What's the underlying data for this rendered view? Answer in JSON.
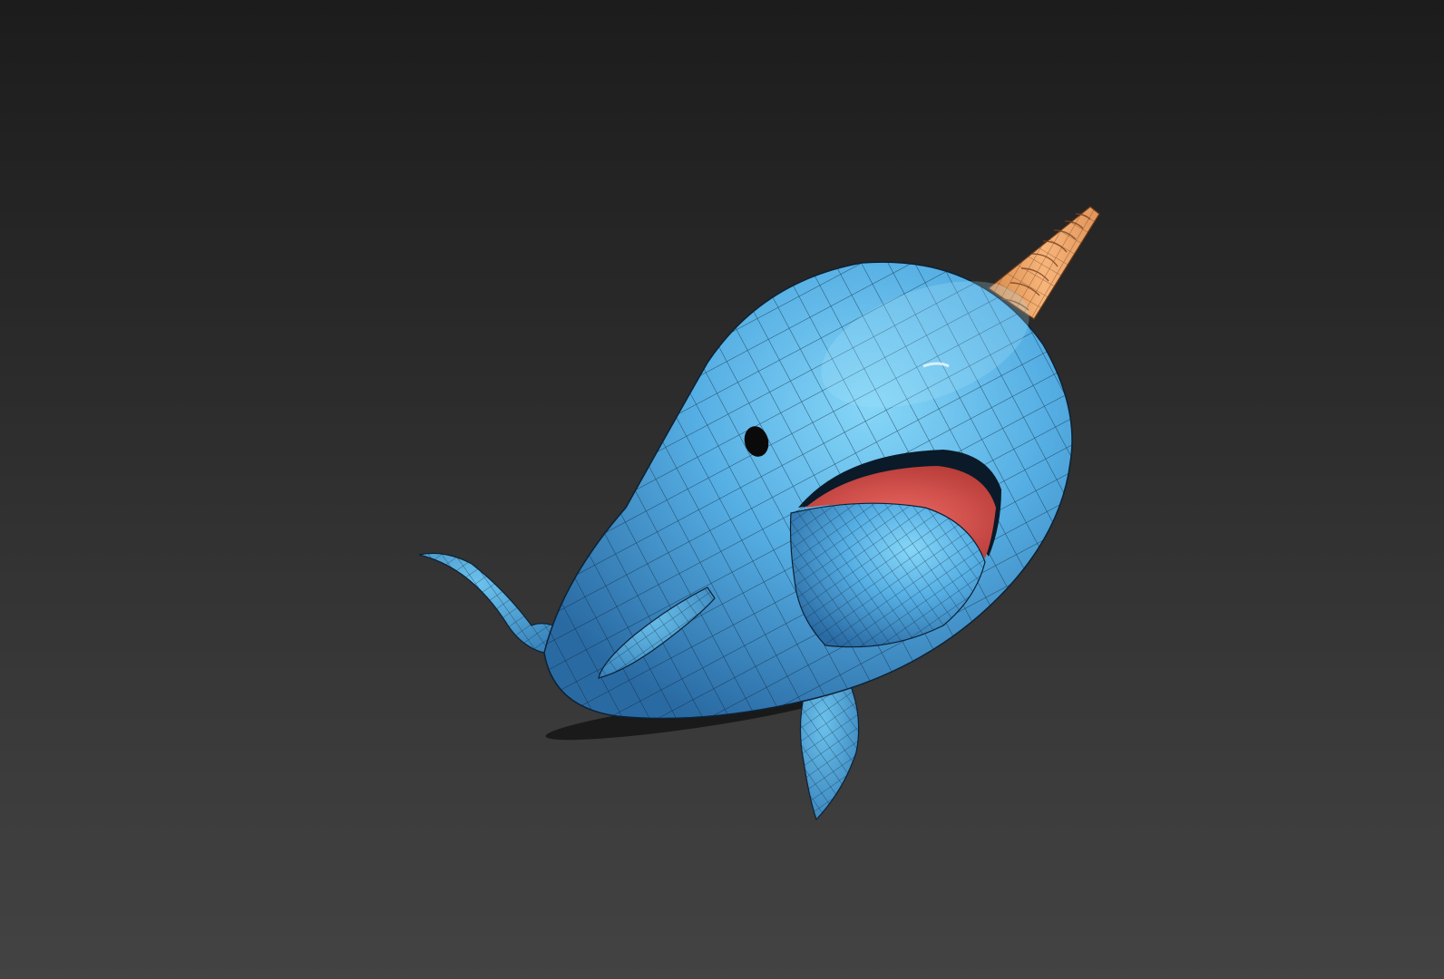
{
  "viewport": {
    "background_top": "#1c1c1c",
    "background_bottom": "#434343"
  },
  "model": {
    "subject": "cartoon narwhal",
    "body_color": "#4fa9e0",
    "body_highlight": "#7fd0f5",
    "body_shadow": "#2a6fa5",
    "tusk_color": "#f0a86a",
    "mouth_color": "#e05550",
    "wireframe_color": "#0c2236",
    "eye_color": "#0a0a0a"
  }
}
